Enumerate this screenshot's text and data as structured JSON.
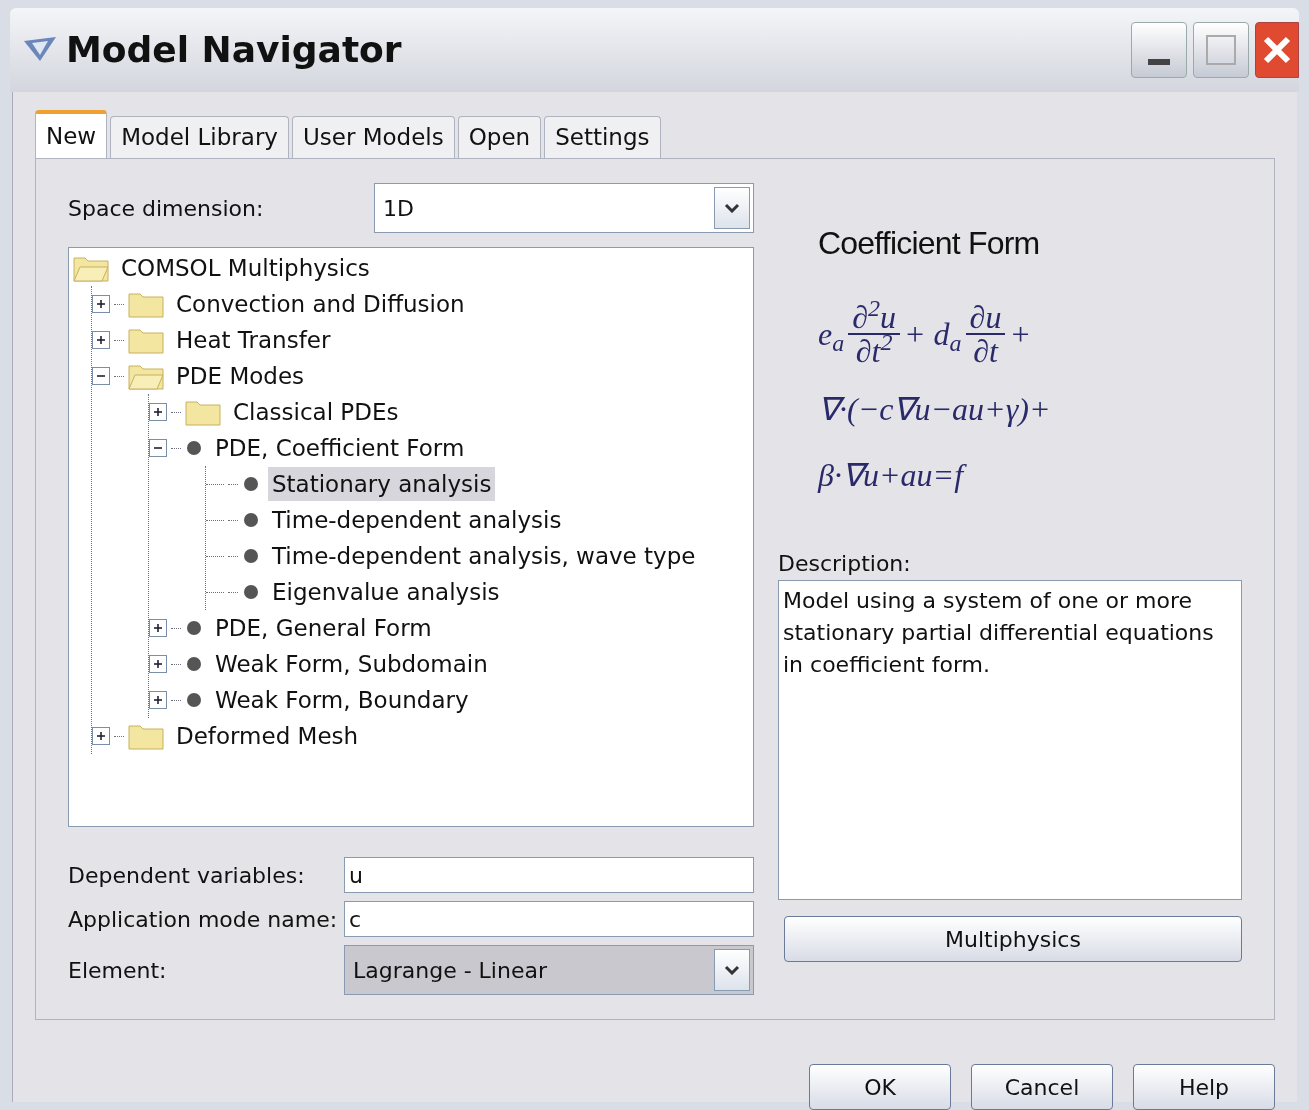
{
  "window": {
    "title": "Model Navigator"
  },
  "tabs": [
    {
      "label": "New",
      "selected": true
    },
    {
      "label": "Model Library",
      "selected": false
    },
    {
      "label": "User Models",
      "selected": false
    },
    {
      "label": "Open",
      "selected": false
    },
    {
      "label": "Settings",
      "selected": false
    }
  ],
  "space_dimension": {
    "label": "Space dimension:",
    "value": "1D"
  },
  "tree": [
    {
      "label": "COMSOL Multiphysics",
      "kind": "folder",
      "expanded": true,
      "selected": false,
      "children": [
        {
          "label": "Convection and Diffusion",
          "kind": "folder",
          "expanded": false,
          "selected": false
        },
        {
          "label": "Heat Transfer",
          "kind": "folder",
          "expanded": false,
          "selected": false
        },
        {
          "label": "PDE Modes",
          "kind": "folder",
          "expanded": true,
          "selected": false,
          "children": [
            {
              "label": "Classical PDEs",
              "kind": "folder",
              "expanded": false,
              "selected": false
            },
            {
              "label": "PDE, Coefficient Form",
              "kind": "mode",
              "expanded": true,
              "selected": false,
              "children": [
                {
                  "label": "Stationary analysis",
                  "kind": "mode",
                  "selected": true
                },
                {
                  "label": "Time-dependent analysis",
                  "kind": "mode",
                  "selected": false
                },
                {
                  "label": "Time-dependent analysis, wave type",
                  "kind": "mode",
                  "selected": false
                },
                {
                  "label": "Eigenvalue analysis",
                  "kind": "mode",
                  "selected": false
                }
              ]
            },
            {
              "label": "PDE, General Form",
              "kind": "mode",
              "expanded": false,
              "selected": false
            },
            {
              "label": "Weak Form, Subdomain",
              "kind": "mode",
              "expanded": false,
              "selected": false
            },
            {
              "label": "Weak Form, Boundary",
              "kind": "mode",
              "expanded": false,
              "selected": false
            }
          ]
        },
        {
          "label": "Deformed Mesh",
          "kind": "folder",
          "expanded": false,
          "selected": false
        }
      ]
    }
  ],
  "fields": [
    {
      "label": "Dependent variables:",
      "kind": "text",
      "value": "u"
    },
    {
      "label": "Application mode name:",
      "kind": "text",
      "value": "c"
    },
    {
      "label": "Element:",
      "kind": "select",
      "value": "Lagrange - Linear"
    }
  ],
  "preview": {
    "title": "Coefficient Form",
    "equation": [
      [
        {
          "kind": "text",
          "text": "e$_{a}$"
        },
        {
          "kind": "frac",
          "num": "∂$^{2}$u",
          "den": "∂t$^{2}$"
        },
        {
          "kind": "text",
          "text": "+ d$_{a}$"
        },
        {
          "kind": "frac",
          "num": "∂u",
          "den": "∂t"
        },
        {
          "kind": "text",
          "text": "+"
        }
      ],
      [
        {
          "kind": "text",
          "text": "∇·(−c∇u−au+γ)+"
        }
      ],
      [
        {
          "kind": "text",
          "text": "β·∇u+au=f"
        }
      ]
    ]
  },
  "description": {
    "label": "Description:",
    "text": "Model using a system of one or more stationary partial differential equations in coefficient form."
  },
  "multiphysics_button": "Multiphysics",
  "buttons": [
    "OK",
    "Cancel",
    "Help"
  ]
}
